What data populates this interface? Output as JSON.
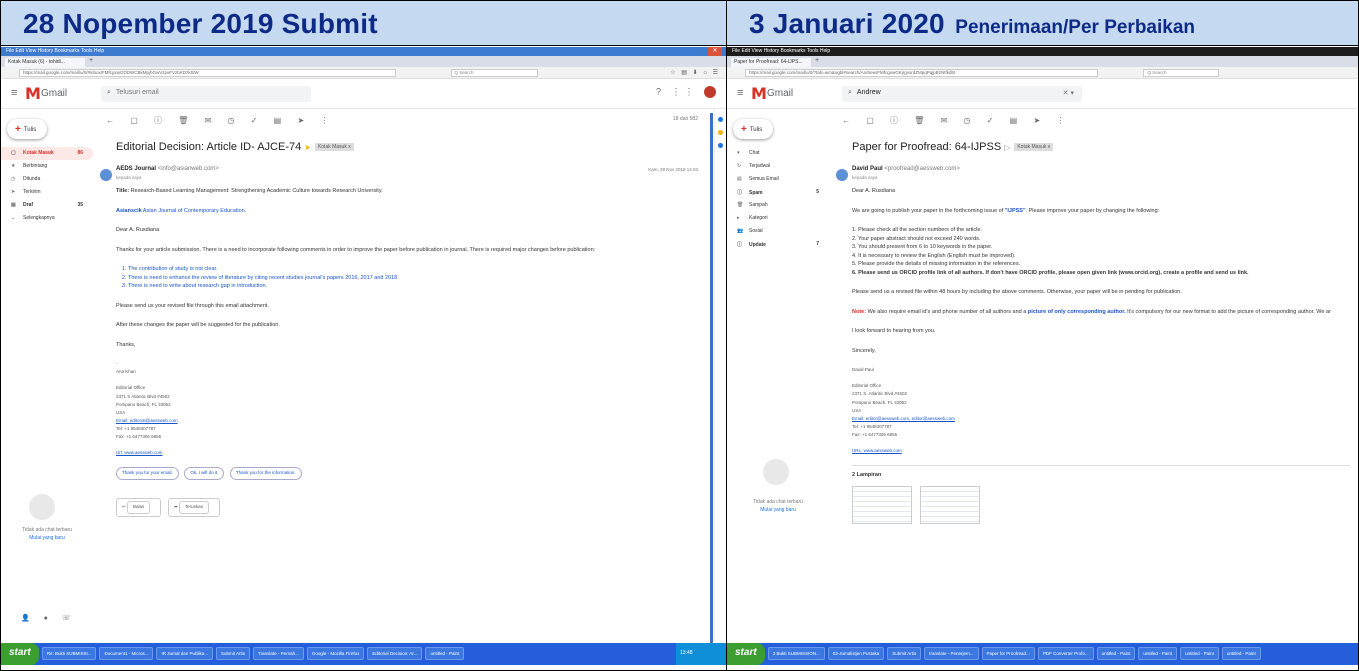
{
  "left": {
    "header": {
      "main": "28 Nopember 2019 Submit",
      "sub": ""
    },
    "browser": {
      "title": "File Edit View History Bookmarks Tools Help",
      "tab": "Kotak Masuk (6) - tohidi...",
      "url": "https://mail.google.com/mail/u/0/#inbox/FMfcgxwGDDWCBkMpjhGwVzpvFVzbKDzkSlW",
      "search": "Q Search"
    },
    "gmail": {
      "logo": "Gmail",
      "search_placeholder": "Telusuri email",
      "compose": "Tulis",
      "nav": [
        {
          "icon": "▢",
          "label": "Kotak Masuk",
          "count": "86"
        },
        {
          "icon": "★",
          "label": "Berbintang",
          "count": ""
        },
        {
          "icon": "◷",
          "label": "Ditunda",
          "count": ""
        },
        {
          "icon": "➤",
          "label": "Terkirim",
          "count": ""
        },
        {
          "icon": "▤",
          "label": "Draf",
          "count": "35"
        },
        {
          "icon": "⌄",
          "label": "Selengkapnya",
          "count": ""
        }
      ],
      "chat_empty": "Tidak ada chat terbaru",
      "chat_link": "Mulai yang baru",
      "pageinfo": "18 dari 582"
    },
    "email": {
      "subject": "Editorial Decision: Article ID- AJCE-74",
      "label": "Kotak Masuk x",
      "from_name": "AEDS Journal",
      "from_email": "<info@asianweb.com>",
      "to": "kepada saya",
      "date": "Kam, 28 Nov 2019 14.03",
      "title_line_label": "Title:",
      "title_line": "Research-Based Learning Management: Strengthening Academic Culture towards Research University.",
      "journal_link": "Asianscik",
      "journal_name": "Asian Journal of Contemporary Education.",
      "greeting": "Dear A. Rusdiana",
      "intro": "Thanks for your article submission. There is a need to incorporate following comments in order to improve the paper before publication in journal. There is required major changes before publication:",
      "items": [
        "The contribution of study is not clear.",
        "There is need to enhance the review of literature by citing recent studies journal's papers 2016, 2017 and 2018",
        "There is need to write about research gap in introduction."
      ],
      "resend": "Please send us your revised file through this email attachment.",
      "after": "After these changes the paper will be suggested for the publication.",
      "thanks": "Thanks,",
      "sig": [
        "-",
        "Ana Khan",
        "",
        "Editorial Office",
        "2371 S Atlantic Blvd #4502",
        "Pompano Beach, FL 33062",
        "USA",
        "Email: editorial@aessweb.com",
        "Tel: +1 9548307787",
        "Fax: +1 6477306 6855",
        "",
        "Url: www.aessweb.com"
      ],
      "smart_replies": [
        "Thank you for your email.",
        "Ok, I will do it.",
        "Thank you for the information."
      ],
      "reply": "Balas",
      "forward": "Teruskan"
    },
    "taskbar": {
      "start": "start",
      "items": [
        "Re: Bukti SUBMISSI...",
        "Document1 - Micros...",
        "IR Jurnal dan Publika...",
        "Submit Artis",
        "Translate - Pernah...",
        "Google - Mozilla Firefox",
        "Editorial Decision: Ar...",
        "untitled - Paint"
      ],
      "clock": "13:48"
    }
  },
  "right": {
    "header": {
      "main": "3 Januari  2020",
      "sub": "Penerimaan/Per Perbaikan"
    },
    "browser": {
      "title": "File Edit View History Bookmarks Tools Help",
      "tab": "Paper for Proofread: 64-IJPS...",
      "url": "https://mail.google.com/mail/u/0/?tab=wm&ogbl#search/Andrew/FMfcgxwGKjrgvxrdZMpqPqjpBzNtfkdbt",
      "search": "Q Search"
    },
    "gmail": {
      "logo": "Gmail",
      "search_value": "Andrew",
      "compose": "Tulis",
      "nav": [
        {
          "icon": "▾",
          "label": "Chat",
          "count": ""
        },
        {
          "icon": "↻",
          "label": "Terjadwal",
          "count": ""
        },
        {
          "icon": "▤",
          "label": "Semua Email",
          "count": ""
        },
        {
          "icon": "ⓘ",
          "label": "Spam",
          "count": "5"
        },
        {
          "icon": "🗑",
          "label": "Sampah",
          "count": ""
        },
        {
          "icon": "▸",
          "label": "Kategori",
          "count": ""
        },
        {
          "icon": "👥",
          "label": "Sosial",
          "count": ""
        },
        {
          "icon": "ⓘ",
          "label": "Update",
          "count": "7"
        }
      ],
      "chat_empty": "Tidak ada chat terbaru",
      "chat_link": "Mulai yang baru"
    },
    "email": {
      "subject": "Paper for Proofread: 64-IJPSS",
      "label": "Kotak Masuk x",
      "from_name": "David Paul",
      "from_email": "<proofread@aessweb.com>",
      "to": "kepada saya",
      "greeting": "Dear  A. Rusdiana",
      "intro_a": "We are going to publish your paper in the forthcoming issue of ",
      "intro_journal": "\"IJPSS\"",
      "intro_b": ". Please improve your paper by changing the following:",
      "items": [
        "1. Please check all the section numbers of the article.",
        "2. Your paper abstract should not exceed 240 words.",
        "3. You should present from 6 to 10 keywords in the paper.",
        "4. It is necessary to review the English (English must be improved).",
        "5. Please provide the details of missing information in the references.",
        "6. Please send us ORCID profile link of all authors. If don't have ORCID profile, please open given link (www.orcid.org), create a profile and send us link."
      ],
      "resend": "Please send us a revised file within 48 hours by including the above comments. Otherwise, your paper will be in pending for publication.",
      "note_label": "Note:",
      "note_a": " We also require email id's and phone number of all authors and a ",
      "note_link": "picture of only corresponding author.",
      "note_b": " It's compulsory for our new format to add the picture of corresponding author. We ar",
      "forward": "I look forward to hearing from you.",
      "closing": "Sincerely,",
      "sig": [
        "David Paul",
        "",
        "Editorial Office",
        "2371 S. Atlantic Blvd #4502",
        "Pompano Beach, FL 33062",
        "USA",
        "Email: editor@aessweb.com, editor@aessweb.com",
        "Tel: +1 9548307787",
        "Fax: +1 6477306 6855",
        "",
        "URL: www.aessweb.com"
      ],
      "attachments": "2 Lampiran"
    },
    "taskbar": {
      "start": "start",
      "items": [
        "3 Bukti SUBMISSION...",
        "03-Jumalistjen Pustaka",
        "Submit Artis",
        "translate - Penerjem...",
        "Paper for Proofread...",
        "PDF Converter Profe...",
        "untitled - Paint",
        "untitled - Paint",
        "untitled - Paint",
        "untitled - Paint"
      ]
    }
  }
}
